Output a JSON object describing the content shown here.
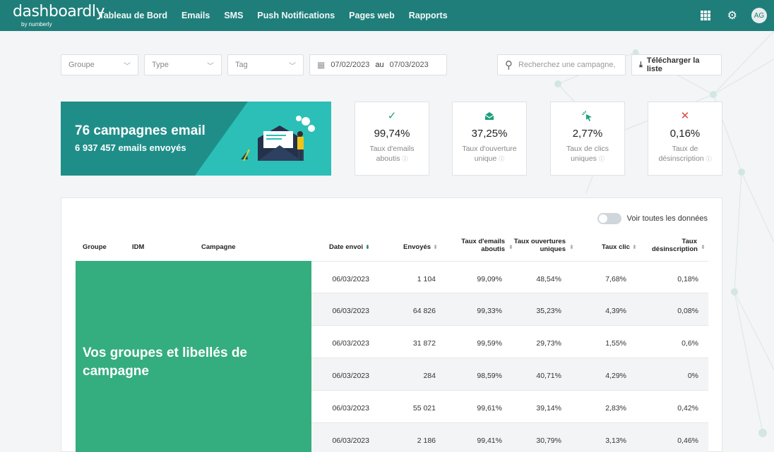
{
  "nav": {
    "logo": "dashboardly",
    "logo_sub": "by numberly",
    "links": [
      "Tableau de Bord",
      "Emails",
      "SMS",
      "Push Notifications",
      "Pages web",
      "Rapports"
    ],
    "avatar": "AG"
  },
  "filters": {
    "groupe": "Groupe",
    "type": "Type",
    "tag": "Tag",
    "date_from": "07/02/2023",
    "date_sep": "au",
    "date_to": "07/03/2023",
    "search_placeholder": "Recherchez une campagne,",
    "download_label": "Télécharger la liste"
  },
  "hero": {
    "title": "76 campagnes email",
    "subtitle": "6 937 457 emails envoyés"
  },
  "kpis": [
    {
      "icon": "check-icon",
      "value": "99,74%",
      "label1": "Taux d'emails",
      "label2": "aboutis"
    },
    {
      "icon": "envelope-open-icon",
      "value": "37,25%",
      "label1": "Taux d'ouverture",
      "label2": "unique"
    },
    {
      "icon": "cursor-click-icon",
      "value": "2,77%",
      "label1": "Taux de clics",
      "label2": "uniques"
    },
    {
      "icon": "cross-icon",
      "value": "0,16%",
      "label1": "Taux de",
      "label2": "désinscription"
    }
  ],
  "toggle_label": "Voir toutes les données",
  "table": {
    "headers": {
      "groupe": "Groupe",
      "idm": "IDM",
      "campagne": "Campagne",
      "date": "Date envoi",
      "envoyes": "Envoyés",
      "aboutis_1": "Taux d'emails",
      "aboutis_2": "aboutis",
      "ouvertures_1": "Taux ouvertures",
      "ouvertures_2": "uniques",
      "clic": "Taux clic",
      "desinsc_1": "Taux",
      "desinsc_2": "désinscription"
    },
    "group_text": "Vos groupes et libellés de campagne",
    "rows": [
      {
        "date": "06/03/2023",
        "envoyes": "1 104",
        "aboutis": "99,09%",
        "ouvertures": "48,54%",
        "clic": "7,68%",
        "desinsc": "0,18%"
      },
      {
        "date": "06/03/2023",
        "envoyes": "64 826",
        "aboutis": "99,33%",
        "ouvertures": "35,23%",
        "clic": "4,39%",
        "desinsc": "0,08%"
      },
      {
        "date": "06/03/2023",
        "envoyes": "31 872",
        "aboutis": "99,59%",
        "ouvertures": "29,73%",
        "clic": "1,55%",
        "desinsc": "0,6%"
      },
      {
        "date": "06/03/2023",
        "envoyes": "284",
        "aboutis": "98,59%",
        "ouvertures": "40,71%",
        "clic": "4,29%",
        "desinsc": "0%"
      },
      {
        "date": "06/03/2023",
        "envoyes": "55 021",
        "aboutis": "99,61%",
        "ouvertures": "39,14%",
        "clic": "2,83%",
        "desinsc": "0,42%"
      },
      {
        "date": "06/03/2023",
        "envoyes": "2 186",
        "aboutis": "99,41%",
        "ouvertures": "30,79%",
        "clic": "3,13%",
        "desinsc": "0,46%"
      }
    ]
  },
  "colors": {
    "nav": "#1f7e7a",
    "hero_dark": "#1f8e89",
    "hero_light": "#2bbfb7",
    "group_block": "#34ad7f",
    "check": "#1f9e7c",
    "cross": "#e0463f"
  }
}
